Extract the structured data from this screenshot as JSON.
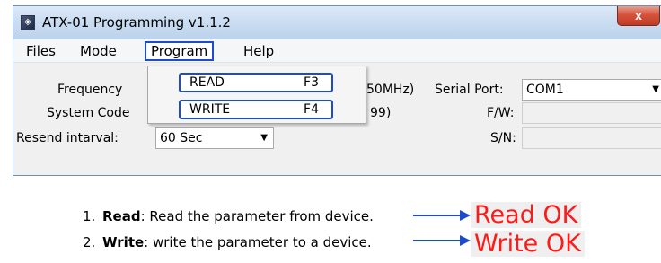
{
  "window": {
    "title": "ATX-01 Programming v1.1.2",
    "app_icon": "app-icon",
    "close_glyph": "x"
  },
  "menubar": {
    "items": [
      {
        "label": "Files"
      },
      {
        "label": "Mode"
      },
      {
        "label": "Program"
      },
      {
        "label": "Help"
      }
    ]
  },
  "form": {
    "frequency_label": "Frequency",
    "frequency_hint": "50MHz)",
    "system_code_label": "System Code",
    "system_code_hint": "99)",
    "resend_label": "Resend intarval:",
    "resend_value": "60 Sec",
    "serial_port_label": "Serial Port:",
    "serial_port_value": "COM1",
    "fw_label": "F/W:",
    "sn_label": "S/N:"
  },
  "program_menu": {
    "items": [
      {
        "label": "READ",
        "shortcut": "F3"
      },
      {
        "label": "WRITE",
        "shortcut": "F4"
      }
    ]
  },
  "instructions": [
    {
      "num": "1.",
      "bold": "Read",
      "text": ": Read the parameter from device.",
      "result": "Read OK"
    },
    {
      "num": "2.",
      "bold": "Write",
      "text": ": write the parameter to a device.",
      "result": "Write OK"
    }
  ],
  "colors": {
    "highlight_border": "#1c4bd0",
    "result_text": "#ff1a1a",
    "arrow": "#1c4bd0"
  }
}
